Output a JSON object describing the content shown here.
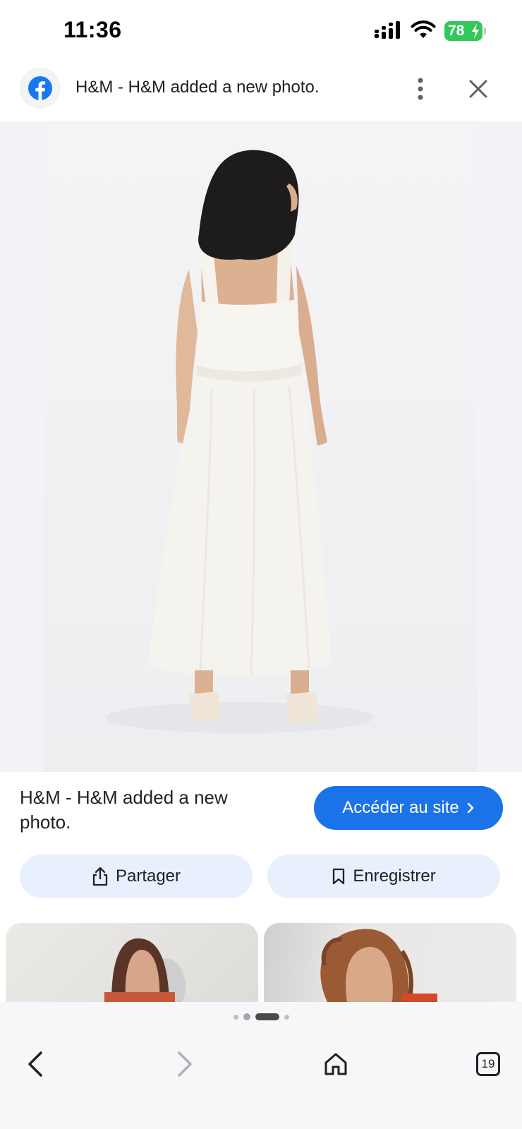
{
  "status_bar": {
    "time": "11:36",
    "battery_level": "78",
    "icons": [
      "signal-icon",
      "wifi-icon",
      "battery-icon"
    ]
  },
  "header": {
    "source_icon": "facebook-icon",
    "title": "H&M - H&M added a new photo.",
    "menu_icon": "more-vert-icon",
    "close_icon": "close-icon"
  },
  "main_image": {
    "alt": "H&M - H&M added a new photo."
  },
  "info": {
    "caption": "H&M - H&M added a new photo.",
    "visit_label": "Accéder au site",
    "visit_icon": "chevron-right-icon"
  },
  "actions": {
    "share_label": "Partager",
    "share_icon": "share-icon",
    "save_label": "Enregistrer",
    "save_icon": "bookmark-icon"
  },
  "pager": {
    "count": 4,
    "active_index": 2
  },
  "bottom_nav": {
    "back_icon": "back-icon",
    "forward_icon": "forward-icon",
    "home_icon": "home-icon",
    "tab_count": "19"
  },
  "colors": {
    "accent": "#1a73e8",
    "pill_bg": "#e8f0fe",
    "facebook": "#1877f2",
    "battery": "#34c759"
  }
}
